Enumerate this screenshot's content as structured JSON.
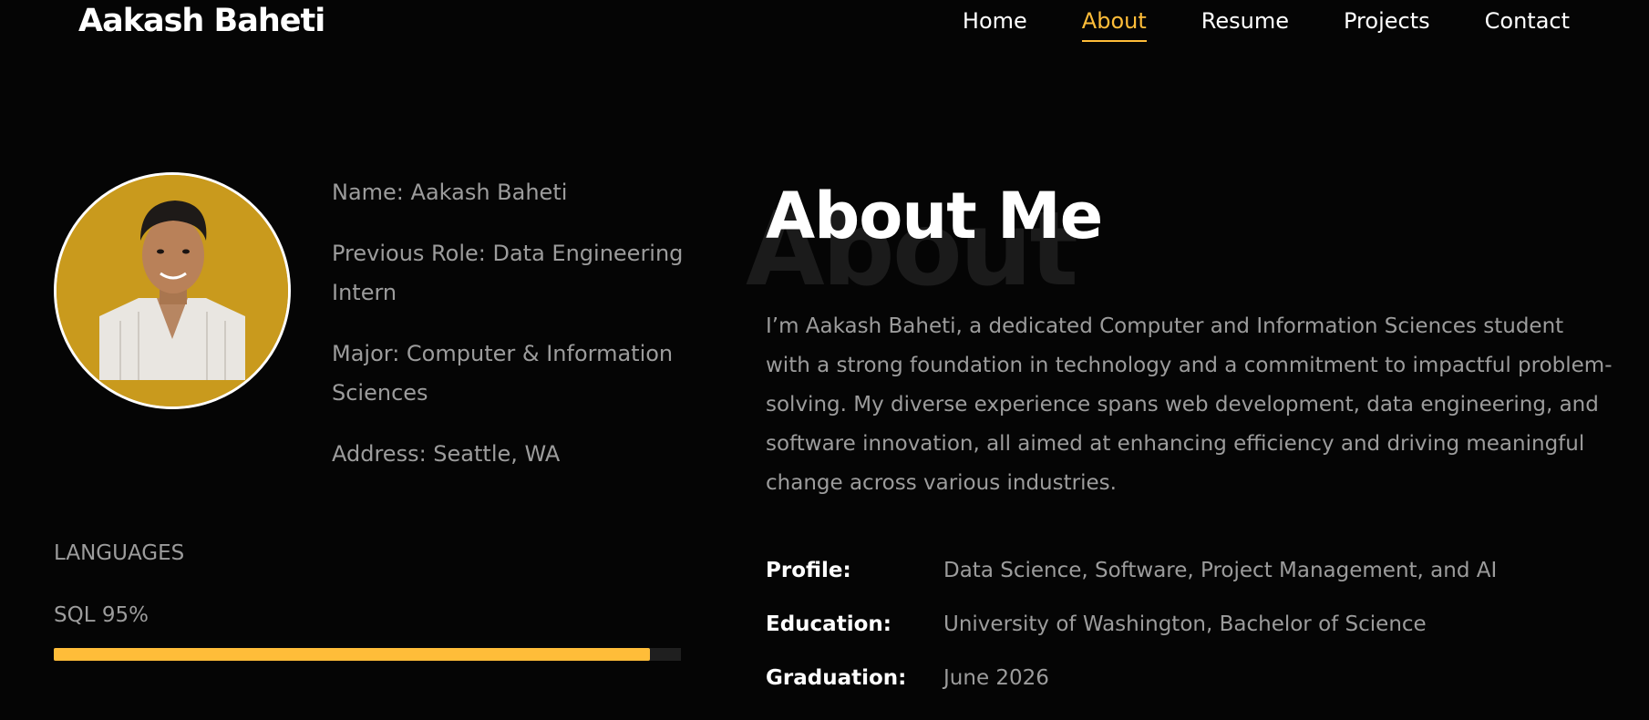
{
  "header": {
    "logo": "Aakash Baheti",
    "nav": [
      {
        "label": "Home",
        "active": false
      },
      {
        "label": "About",
        "active": true
      },
      {
        "label": "Resume",
        "active": false
      },
      {
        "label": "Projects",
        "active": false
      },
      {
        "label": "Contact",
        "active": false
      }
    ]
  },
  "profile": {
    "photo_alt": "profile-photo",
    "info": [
      "Name: Aakash Baheti",
      "Previous Role: Data Engineering Intern",
      "Major: Computer & Information Sciences",
      "Address: Seattle, WA"
    ]
  },
  "languages": {
    "heading": "LANGUAGES",
    "skills": [
      {
        "label": "SQL 95%",
        "percent": 95
      }
    ]
  },
  "about": {
    "background_word": "About",
    "title": "About Me",
    "paragraph": "I’m Aakash Baheti, a dedicated Computer and Information Sciences student with a strong foundation in technology and a commitment to impactful problem-solving. My diverse experience spans web development, data engineering, and software innovation, all aimed at enhancing efficiency and driving meaningful change across various industries.",
    "details": [
      {
        "key": "Profile:",
        "value": "Data Science, Software, Project Management, and AI"
      },
      {
        "key": "Education:",
        "value": "University of Washington, Bachelor of Science"
      },
      {
        "key": "Graduation:",
        "value": "June 2026"
      }
    ]
  },
  "colors": {
    "accent": "#ffbd39",
    "background": "#050505",
    "muted_text": "#9c9c9c",
    "avatar_bg": "#c99a1d"
  }
}
